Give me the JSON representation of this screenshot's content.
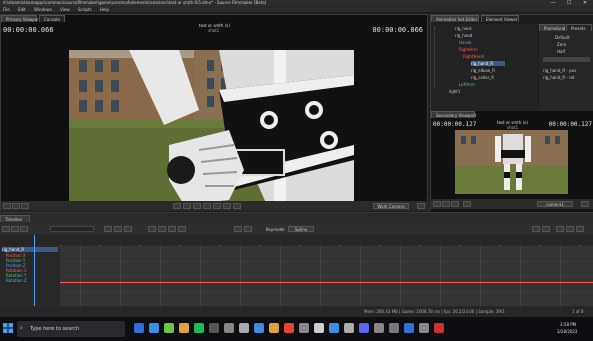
{
  "window": {
    "title": "d:\\steam\\steamapps\\common\\sourcefilmmaker\\game\\usermod\\elements\\sessions\\test or smth 6\\5.dmx* - Source Filmmaker [Beta]",
    "minimize": "—",
    "maximize": "☐",
    "close": "✕"
  },
  "menu": [
    "File",
    "Edit",
    "Windows",
    "View",
    "Scripts",
    "Help"
  ],
  "primary": {
    "tabs": [
      "Primary Viewport",
      "Console"
    ],
    "timecode_left": "00:00:00.066",
    "timecode_right": "00:00:00.066",
    "shot_title": "test or smth (s)",
    "shot_sub": "shot1",
    "camera_button": "Work Camera"
  },
  "animation_set_editor": {
    "tabs": [
      "Animation Set Editor",
      "Element Viewer"
    ],
    "tree": [
      {
        "label": "rig_neck",
        "color": "#c8c8c8"
      },
      {
        "label": "rig_head",
        "color": "#c8c8c8"
      },
      {
        "label": "Hands",
        "color": "#4fa3ff"
      },
      {
        "label": "RightArm",
        "color": "#ff5a5a"
      },
      {
        "label": "RightHand",
        "color": "#ff5a5a"
      },
      {
        "label": "rig_hand_R",
        "color": "#ffffff"
      },
      {
        "label": "rig_elbow_R",
        "color": "#c8c8c8"
      },
      {
        "label": "rig_collar_R",
        "color": "#c8c8c8"
      },
      {
        "label": "LeftArm",
        "color": "#3cd070"
      },
      {
        "label": "light1",
        "color": "#c8c8c8"
      }
    ],
    "preset_tabs": [
      "Procedural",
      "Presets"
    ],
    "presets": [
      "Default",
      "Zero",
      "Half"
    ],
    "rig_list": [
      "rig_hand_R - pos",
      "rig_hand_R - rot"
    ]
  },
  "secondary": {
    "tab": "Secondary Viewport",
    "timecode_left": "00:00:00.127",
    "timecode_right": "00:00:00.127",
    "shot_title": "test or smth (s)",
    "shot_sub": "shot1",
    "camera_button": "camera1"
  },
  "timeline": {
    "tab": "Timeline",
    "keyframe_label": "Keymode",
    "spline_label": "Spline",
    "channels": [
      {
        "label": "rig_hand_R",
        "color": "#c8c8c8"
      },
      {
        "label": "Position X",
        "color": "#ff5a5a"
      },
      {
        "label": "Position Y",
        "color": "#3cd070"
      },
      {
        "label": "Position Z",
        "color": "#4fa3ff"
      },
      {
        "label": "Rotation X",
        "color": "#ff5a5a"
      },
      {
        "label": "Rotation Y",
        "color": "#3cd070"
      },
      {
        "label": "Rotation Z",
        "color": "#4fa3ff"
      }
    ],
    "status": "Mem:   280.43 MB | Game:    1008.78 ms | fps:    26.2/24.00 | Sample:    39/1",
    "page": "1 of 8"
  },
  "taskbar": {
    "search_placeholder": "Type here to search",
    "time": "3:58 PM",
    "date": "3/28/2022",
    "icon_colors": [
      "#2f6fd6",
      "#3a8de0",
      "#6cc24a",
      "#e0a43a",
      "#1db954",
      "#555",
      "#888",
      "#aaa",
      "#3a8de0",
      "#e0a43a",
      "#ea4335",
      "#888",
      "#ccc",
      "#3a8de0",
      "#aaa",
      "#5865f2",
      "#888",
      "#777",
      "#2f6fd6",
      "#888",
      "#d03030"
    ]
  }
}
